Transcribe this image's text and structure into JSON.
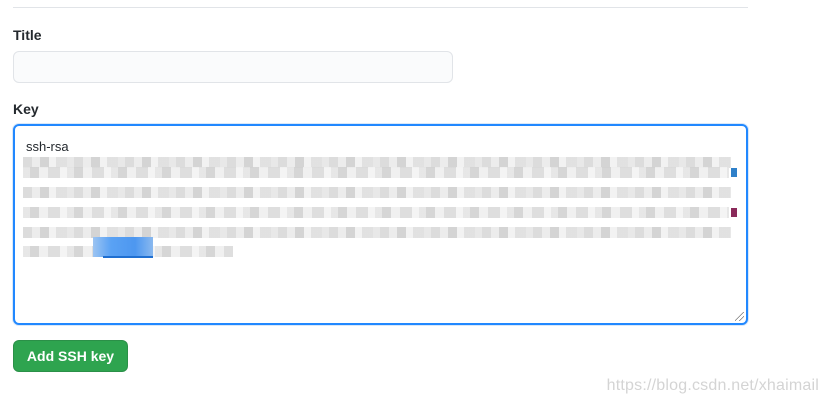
{
  "form": {
    "title_label": "Title",
    "title_value": "",
    "title_placeholder": "",
    "key_label": "Key",
    "key_prefix": "ssh-rsa",
    "submit_label": "Add SSH key"
  },
  "colors": {
    "submit_background": "#2ea44f",
    "focus_border": "#2188ff",
    "input_background": "#fafbfc"
  },
  "watermark": {
    "text": "https://blog.csdn.net/xhaimail"
  }
}
